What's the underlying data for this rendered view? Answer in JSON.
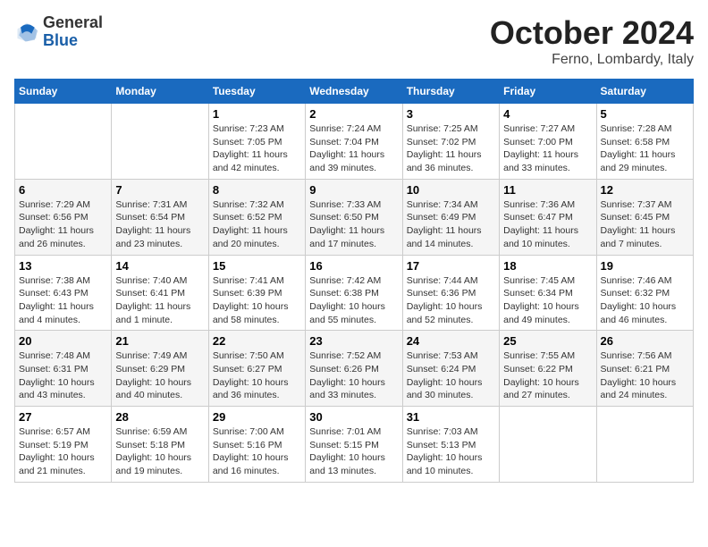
{
  "header": {
    "logo_general": "General",
    "logo_blue": "Blue",
    "month_title": "October 2024",
    "location": "Ferno, Lombardy, Italy"
  },
  "weekdays": [
    "Sunday",
    "Monday",
    "Tuesday",
    "Wednesday",
    "Thursday",
    "Friday",
    "Saturday"
  ],
  "weeks": [
    [
      {
        "day": "",
        "detail": ""
      },
      {
        "day": "",
        "detail": ""
      },
      {
        "day": "1",
        "detail": "Sunrise: 7:23 AM\nSunset: 7:05 PM\nDaylight: 11 hours and 42 minutes."
      },
      {
        "day": "2",
        "detail": "Sunrise: 7:24 AM\nSunset: 7:04 PM\nDaylight: 11 hours and 39 minutes."
      },
      {
        "day": "3",
        "detail": "Sunrise: 7:25 AM\nSunset: 7:02 PM\nDaylight: 11 hours and 36 minutes."
      },
      {
        "day": "4",
        "detail": "Sunrise: 7:27 AM\nSunset: 7:00 PM\nDaylight: 11 hours and 33 minutes."
      },
      {
        "day": "5",
        "detail": "Sunrise: 7:28 AM\nSunset: 6:58 PM\nDaylight: 11 hours and 29 minutes."
      }
    ],
    [
      {
        "day": "6",
        "detail": "Sunrise: 7:29 AM\nSunset: 6:56 PM\nDaylight: 11 hours and 26 minutes."
      },
      {
        "day": "7",
        "detail": "Sunrise: 7:31 AM\nSunset: 6:54 PM\nDaylight: 11 hours and 23 minutes."
      },
      {
        "day": "8",
        "detail": "Sunrise: 7:32 AM\nSunset: 6:52 PM\nDaylight: 11 hours and 20 minutes."
      },
      {
        "day": "9",
        "detail": "Sunrise: 7:33 AM\nSunset: 6:50 PM\nDaylight: 11 hours and 17 minutes."
      },
      {
        "day": "10",
        "detail": "Sunrise: 7:34 AM\nSunset: 6:49 PM\nDaylight: 11 hours and 14 minutes."
      },
      {
        "day": "11",
        "detail": "Sunrise: 7:36 AM\nSunset: 6:47 PM\nDaylight: 11 hours and 10 minutes."
      },
      {
        "day": "12",
        "detail": "Sunrise: 7:37 AM\nSunset: 6:45 PM\nDaylight: 11 hours and 7 minutes."
      }
    ],
    [
      {
        "day": "13",
        "detail": "Sunrise: 7:38 AM\nSunset: 6:43 PM\nDaylight: 11 hours and 4 minutes."
      },
      {
        "day": "14",
        "detail": "Sunrise: 7:40 AM\nSunset: 6:41 PM\nDaylight: 11 hours and 1 minute."
      },
      {
        "day": "15",
        "detail": "Sunrise: 7:41 AM\nSunset: 6:39 PM\nDaylight: 10 hours and 58 minutes."
      },
      {
        "day": "16",
        "detail": "Sunrise: 7:42 AM\nSunset: 6:38 PM\nDaylight: 10 hours and 55 minutes."
      },
      {
        "day": "17",
        "detail": "Sunrise: 7:44 AM\nSunset: 6:36 PM\nDaylight: 10 hours and 52 minutes."
      },
      {
        "day": "18",
        "detail": "Sunrise: 7:45 AM\nSunset: 6:34 PM\nDaylight: 10 hours and 49 minutes."
      },
      {
        "day": "19",
        "detail": "Sunrise: 7:46 AM\nSunset: 6:32 PM\nDaylight: 10 hours and 46 minutes."
      }
    ],
    [
      {
        "day": "20",
        "detail": "Sunrise: 7:48 AM\nSunset: 6:31 PM\nDaylight: 10 hours and 43 minutes."
      },
      {
        "day": "21",
        "detail": "Sunrise: 7:49 AM\nSunset: 6:29 PM\nDaylight: 10 hours and 40 minutes."
      },
      {
        "day": "22",
        "detail": "Sunrise: 7:50 AM\nSunset: 6:27 PM\nDaylight: 10 hours and 36 minutes."
      },
      {
        "day": "23",
        "detail": "Sunrise: 7:52 AM\nSunset: 6:26 PM\nDaylight: 10 hours and 33 minutes."
      },
      {
        "day": "24",
        "detail": "Sunrise: 7:53 AM\nSunset: 6:24 PM\nDaylight: 10 hours and 30 minutes."
      },
      {
        "day": "25",
        "detail": "Sunrise: 7:55 AM\nSunset: 6:22 PM\nDaylight: 10 hours and 27 minutes."
      },
      {
        "day": "26",
        "detail": "Sunrise: 7:56 AM\nSunset: 6:21 PM\nDaylight: 10 hours and 24 minutes."
      }
    ],
    [
      {
        "day": "27",
        "detail": "Sunrise: 6:57 AM\nSunset: 5:19 PM\nDaylight: 10 hours and 21 minutes."
      },
      {
        "day": "28",
        "detail": "Sunrise: 6:59 AM\nSunset: 5:18 PM\nDaylight: 10 hours and 19 minutes."
      },
      {
        "day": "29",
        "detail": "Sunrise: 7:00 AM\nSunset: 5:16 PM\nDaylight: 10 hours and 16 minutes."
      },
      {
        "day": "30",
        "detail": "Sunrise: 7:01 AM\nSunset: 5:15 PM\nDaylight: 10 hours and 13 minutes."
      },
      {
        "day": "31",
        "detail": "Sunrise: 7:03 AM\nSunset: 5:13 PM\nDaylight: 10 hours and 10 minutes."
      },
      {
        "day": "",
        "detail": ""
      },
      {
        "day": "",
        "detail": ""
      }
    ]
  ]
}
